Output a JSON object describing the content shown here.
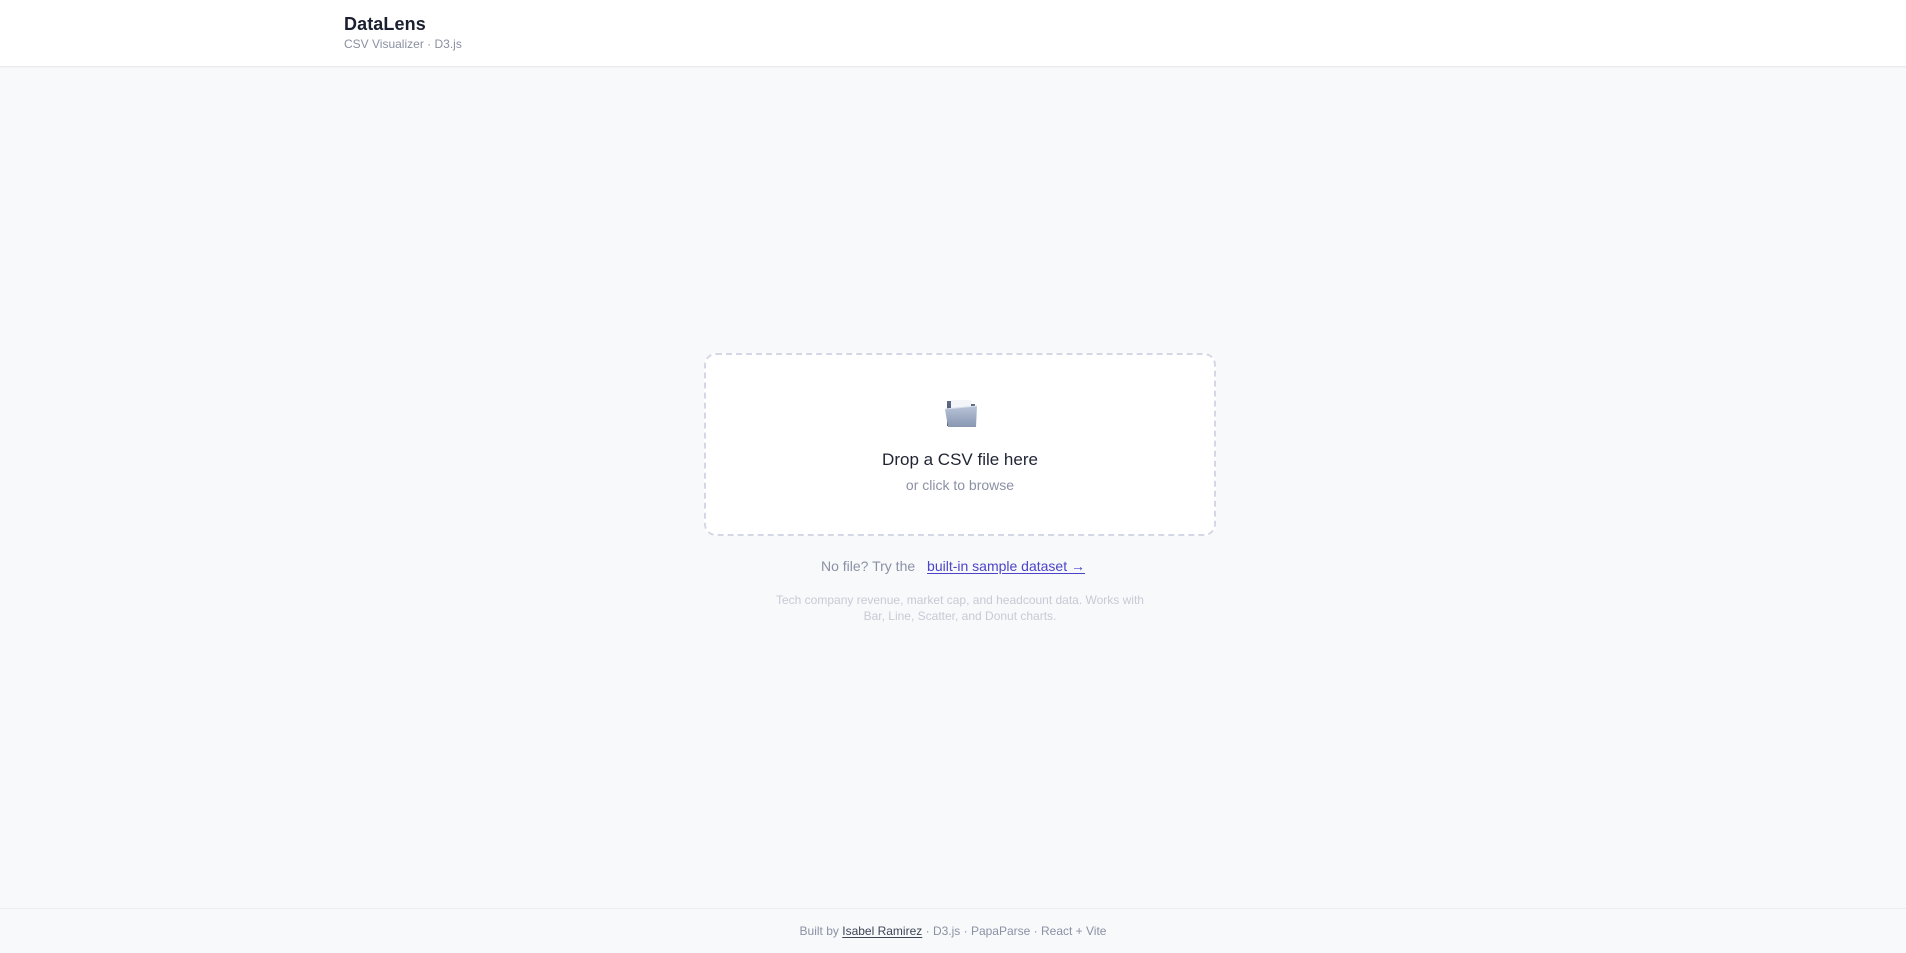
{
  "header": {
    "title": "DataLens",
    "subtitle": "CSV Visualizer · D3.js"
  },
  "dropzone": {
    "icon": "folder-open-icon",
    "title": "Drop a CSV file here",
    "subtitle": "or click to browse"
  },
  "sample": {
    "prompt": "No file? Try the",
    "link_label": "built-in sample dataset →",
    "description": "Tech company revenue, market cap, and headcount data. Works with Bar, Line, Scatter, and Donut charts."
  },
  "footer": {
    "prefix": "Built by",
    "author": "Isabel Ramirez",
    "suffix": "· D3.js · PapaParse · React + Vite"
  },
  "colors": {
    "accent": "#4b44c9",
    "background": "#f8f9fb",
    "border_dashed": "#d4d8e6"
  }
}
